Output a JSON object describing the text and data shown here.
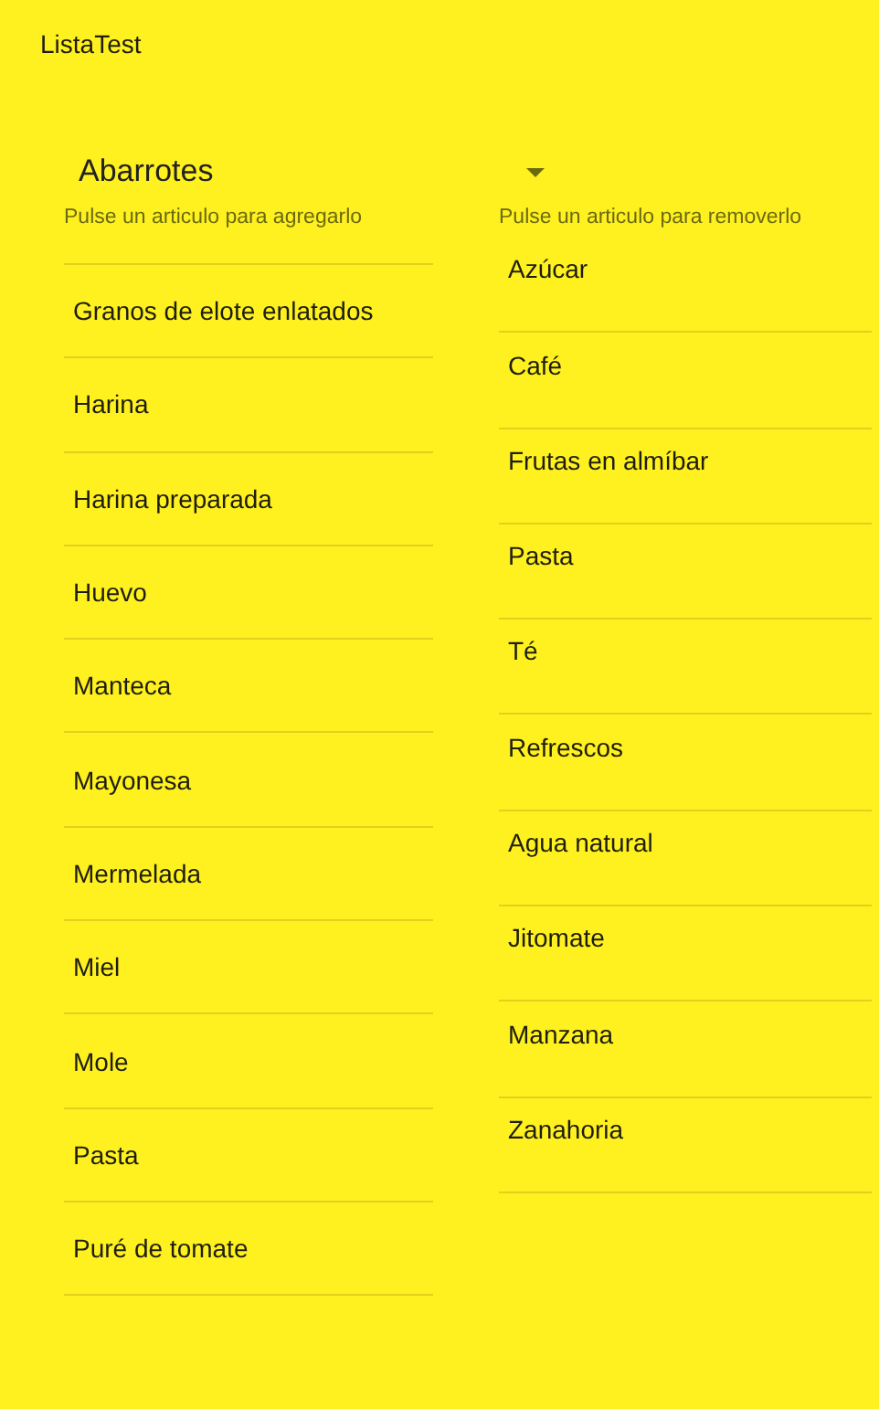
{
  "app_bar": {
    "title": "ListaTest"
  },
  "category_dropdown": {
    "value": "Abarrotes"
  },
  "available_list": {
    "hint": "Pulse un articulo para agregarlo",
    "items": [
      "Granos de elote enlatados",
      "Harina",
      "Harina preparada",
      "Huevo",
      "Manteca",
      "Mayonesa",
      "Mermelada",
      "Miel",
      "Mole",
      "Pasta",
      "Puré de tomate"
    ]
  },
  "selected_list": {
    "hint": "Pulse un articulo para removerlo",
    "items": [
      "Azúcar",
      "Café",
      "Frutas en almíbar",
      "Pasta",
      "Té",
      "Refrescos",
      "Agua natural",
      "Jitomate",
      "Manzana",
      "Zanahoria"
    ]
  }
}
